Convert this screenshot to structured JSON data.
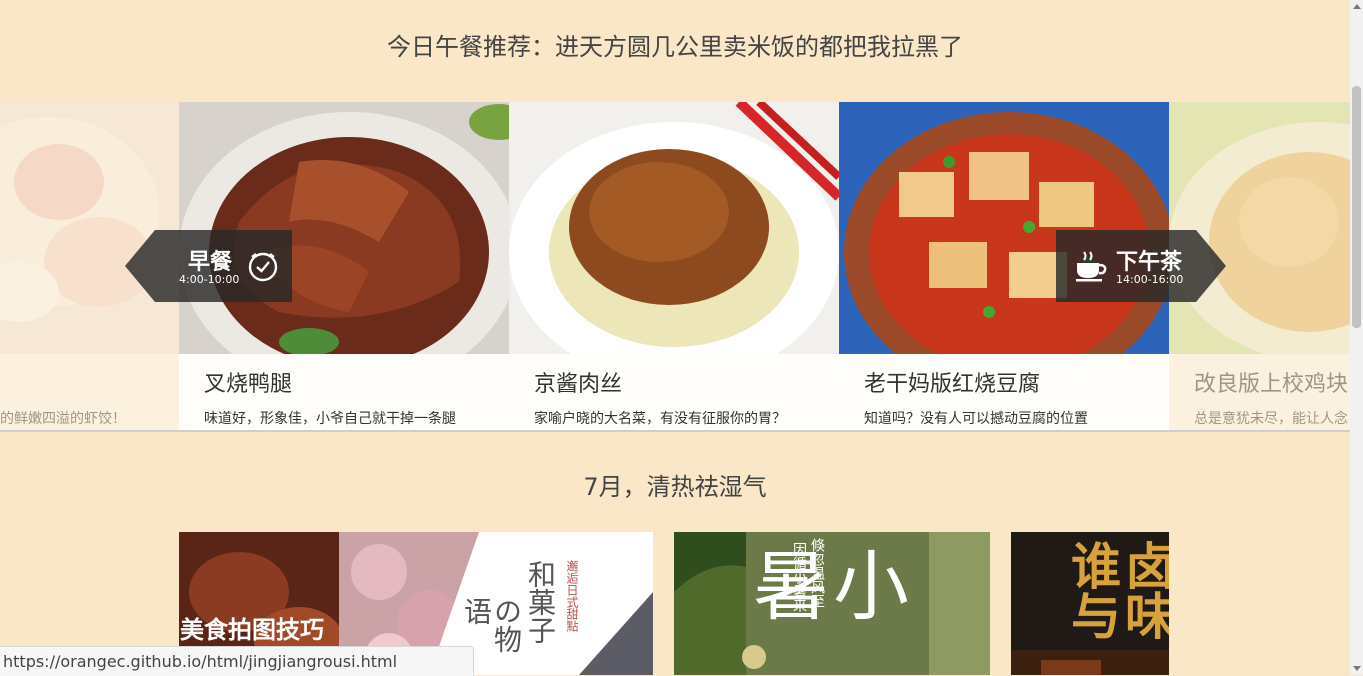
{
  "sections": {
    "lunch_title": "今日午餐推荐：进天方圆几公里卖米饭的都把我拉黑了",
    "july_title": "7月，清热祛湿气"
  },
  "carousel": {
    "cards": [
      {
        "name": "",
        "desc": "的鲜嫩四溢的虾饺！"
      },
      {
        "name": "叉烧鸭腿",
        "desc": "味道好，形象佳，小爷自己就干掉一条腿"
      },
      {
        "name": "京酱肉丝",
        "desc": "家喻户晓的大名菜，有没有征服你的胃？"
      },
      {
        "name": "老干妈版红烧豆腐",
        "desc": "知道吗？没有人可以撼动豆腐的位置"
      },
      {
        "name": "改良版上校鸡块",
        "desc": "总是意犹未尽，能让人念"
      }
    ],
    "prev_tag": {
      "label": "早餐",
      "time": "4:00-10:00",
      "icon": "clock-icon"
    },
    "next_tag": {
      "label": "下午茶",
      "time": "14:00-16:00",
      "icon": "coffee-cup-icon"
    }
  },
  "features": {
    "photo_tips_title": "美食拍图技巧",
    "wagashi_text_1": "和菓子",
    "wagashi_text_2": "の物语",
    "wagashi_side": "邂逅日式甜點",
    "xiaoshu_big": "小暑",
    "xiaoshu_poem_1": "倏忽温风至",
    "xiaoshu_poem_2": "因循小暑来",
    "braise_text_1": "卤味",
    "braise_text_2": "谁与"
  },
  "status_bar": {
    "url": "https://orangec.github.io/html/jingjiangrousi.html"
  }
}
